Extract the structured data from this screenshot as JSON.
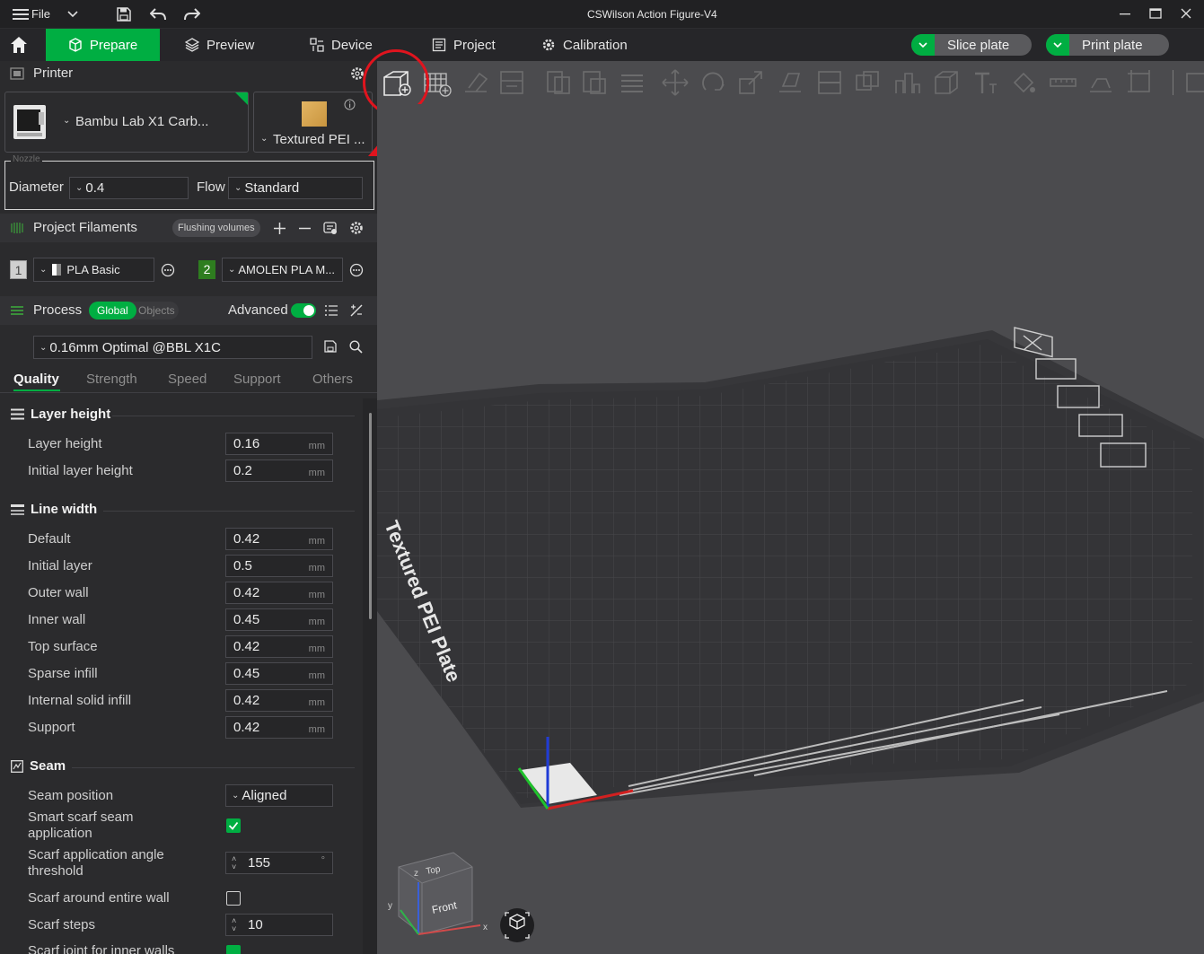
{
  "window": {
    "title": "CSWilson Action Figure-V4",
    "file_menu": "File"
  },
  "nav": {
    "tabs": [
      {
        "label": "Prepare"
      },
      {
        "label": "Preview"
      },
      {
        "label": "Device"
      },
      {
        "label": "Project"
      },
      {
        "label": "Calibration"
      }
    ],
    "slice_button": "Slice plate",
    "print_button": "Print plate"
  },
  "printer": {
    "section_title": "Printer",
    "printer_name": "Bambu Lab X1 Carb...",
    "plate_type": "Textured PEI ...",
    "nozzle_legend": "Nozzle",
    "diameter_label": "Diameter",
    "diameter_value": "0.4",
    "flow_label": "Flow",
    "flow_value": "Standard"
  },
  "filaments": {
    "section_title": "Project Filaments",
    "flushing_button": "Flushing volumes",
    "items": [
      {
        "index": "1",
        "name": "PLA Basic",
        "color": "#e8e8e8"
      },
      {
        "index": "2",
        "name": "AMOLEN PLA M...",
        "color": "#2e7d1f"
      }
    ]
  },
  "process": {
    "section_title": "Process",
    "global_label": "Global",
    "objects_label": "Objects",
    "advanced_label": "Advanced",
    "advanced_on": true,
    "profile": "0.16mm Optimal @BBL X1C",
    "tabs": [
      "Quality",
      "Strength",
      "Speed",
      "Support",
      "Others"
    ],
    "active_tab": "Quality"
  },
  "settings": {
    "layer_height_group": "Layer height",
    "layer_height": {
      "label": "Layer height",
      "value": "0.16",
      "unit": "mm"
    },
    "initial_layer_height": {
      "label": "Initial layer height",
      "value": "0.2",
      "unit": "mm"
    },
    "line_width_group": "Line width",
    "line_widths": [
      {
        "label": "Default",
        "value": "0.42",
        "unit": "mm"
      },
      {
        "label": "Initial layer",
        "value": "0.5",
        "unit": "mm"
      },
      {
        "label": "Outer wall",
        "value": "0.42",
        "unit": "mm"
      },
      {
        "label": "Inner wall",
        "value": "0.45",
        "unit": "mm"
      },
      {
        "label": "Top surface",
        "value": "0.42",
        "unit": "mm"
      },
      {
        "label": "Sparse infill",
        "value": "0.45",
        "unit": "mm"
      },
      {
        "label": "Internal solid infill",
        "value": "0.42",
        "unit": "mm"
      },
      {
        "label": "Support",
        "value": "0.42",
        "unit": "mm"
      }
    ],
    "seam_group": "Seam",
    "seam_position": {
      "label": "Seam position",
      "value": "Aligned"
    },
    "smart_scarf": {
      "label_1": "Smart scarf seam",
      "label_2": "application",
      "checked": true
    },
    "scarf_angle": {
      "label_1": "Scarf application angle",
      "label_2": "threshold",
      "value": "155",
      "unit": "°"
    },
    "scarf_entire_wall": {
      "label": "Scarf around entire wall",
      "checked": false
    },
    "scarf_steps": {
      "label": "Scarf steps",
      "value": "10"
    },
    "scarf_inner_walls": {
      "label": "Scarf joint for inner walls",
      "checked": true
    }
  },
  "viewport": {
    "plate_label": "Textured PEI Plate",
    "view_cube": {
      "top": "Top",
      "front": "Front",
      "axis_x": "x",
      "axis_y": "y",
      "axis_z": "z"
    }
  },
  "colors": {
    "accent": "#00ae42",
    "highlight_red": "#e0141e",
    "panel": "#2b2b2d",
    "viewport": "#4b4b4e"
  }
}
